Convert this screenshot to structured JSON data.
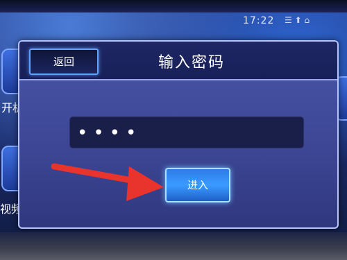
{
  "status_bar": {
    "time": "17:22"
  },
  "background": {
    "left_labels": [
      "开机",
      "视频"
    ]
  },
  "dialog": {
    "back_label": "返回",
    "title": "输入密码",
    "password_value": "••••",
    "enter_label": "进入"
  },
  "colors": {
    "dialog_bg": "#3d4796",
    "header_bg": "#1f2764",
    "accent": "#5ea2ff",
    "arrow": "#e8342c"
  }
}
